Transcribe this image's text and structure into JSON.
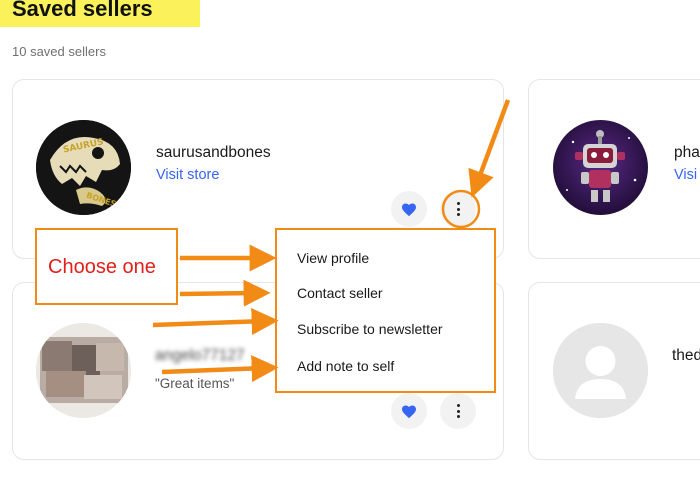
{
  "page": {
    "title": "Saved sellers",
    "count": "10 saved sellers"
  },
  "cards": [
    {
      "name": "saurusandbones",
      "link": "Visit store",
      "avatar_text": "SAURUS BONES"
    },
    {
      "name": "pha",
      "link": "Visi"
    },
    {
      "name": "angelo77127",
      "quote": "\"Great items\""
    },
    {
      "name": "thed"
    }
  ],
  "menu": {
    "items": [
      "View profile",
      "Contact seller",
      "Subscribe to newsletter",
      "Add note to self"
    ]
  },
  "callout": {
    "text": "Choose one"
  },
  "colors": {
    "accent_orange": "#f28a16",
    "link_blue": "#3665f3",
    "heart_blue": "#3665f3",
    "callout_red": "#e0201b",
    "title_highlight": "#fbf15a"
  },
  "icons": [
    "heart-icon",
    "more-options-icon",
    "default-avatar-icon"
  ]
}
